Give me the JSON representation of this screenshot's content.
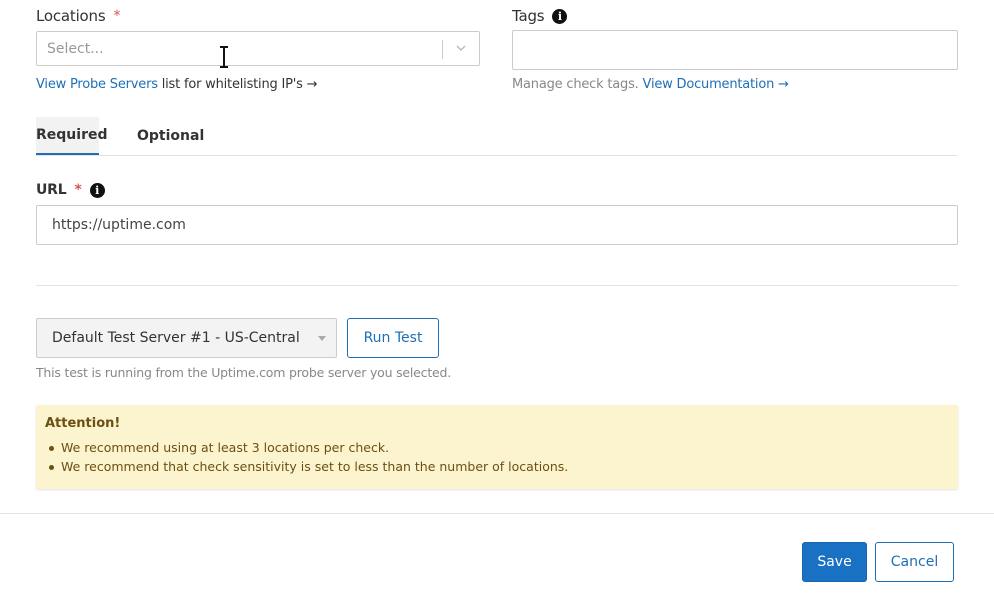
{
  "locations": {
    "label": "Locations",
    "required_mark": "*",
    "placeholder": "Select...",
    "help_link": "View Probe Servers",
    "help_text": " list for whitelisting IP's →"
  },
  "tags": {
    "label": "Tags",
    "value": "",
    "help_text": "Manage check tags. ",
    "help_link": "View Documentation →"
  },
  "tabs": [
    {
      "label": "Required",
      "active": true
    },
    {
      "label": "Optional",
      "active": false
    }
  ],
  "url": {
    "label": "URL",
    "required_mark": "*",
    "value": "https://uptime.com"
  },
  "test": {
    "server_selected": "Default Test Server #1 - US-Central",
    "run_label": "Run Test",
    "note": "This test is running from the Uptime.com probe server you selected."
  },
  "alert": {
    "title": "Attention!",
    "items": [
      "We recommend using at least 3 locations per check.",
      "We recommend that check sensitivity is set to less than the number of locations."
    ]
  },
  "footer": {
    "save_label": "Save",
    "cancel_label": "Cancel"
  },
  "icons": {
    "info": "info-icon",
    "chevron": "chevron-down-icon",
    "cursor": "text-cursor-icon"
  },
  "colors": {
    "link": "#1e6fb5",
    "primary": "#1871c2",
    "required": "#d9534f",
    "alert_bg": "#fcf4cf"
  }
}
